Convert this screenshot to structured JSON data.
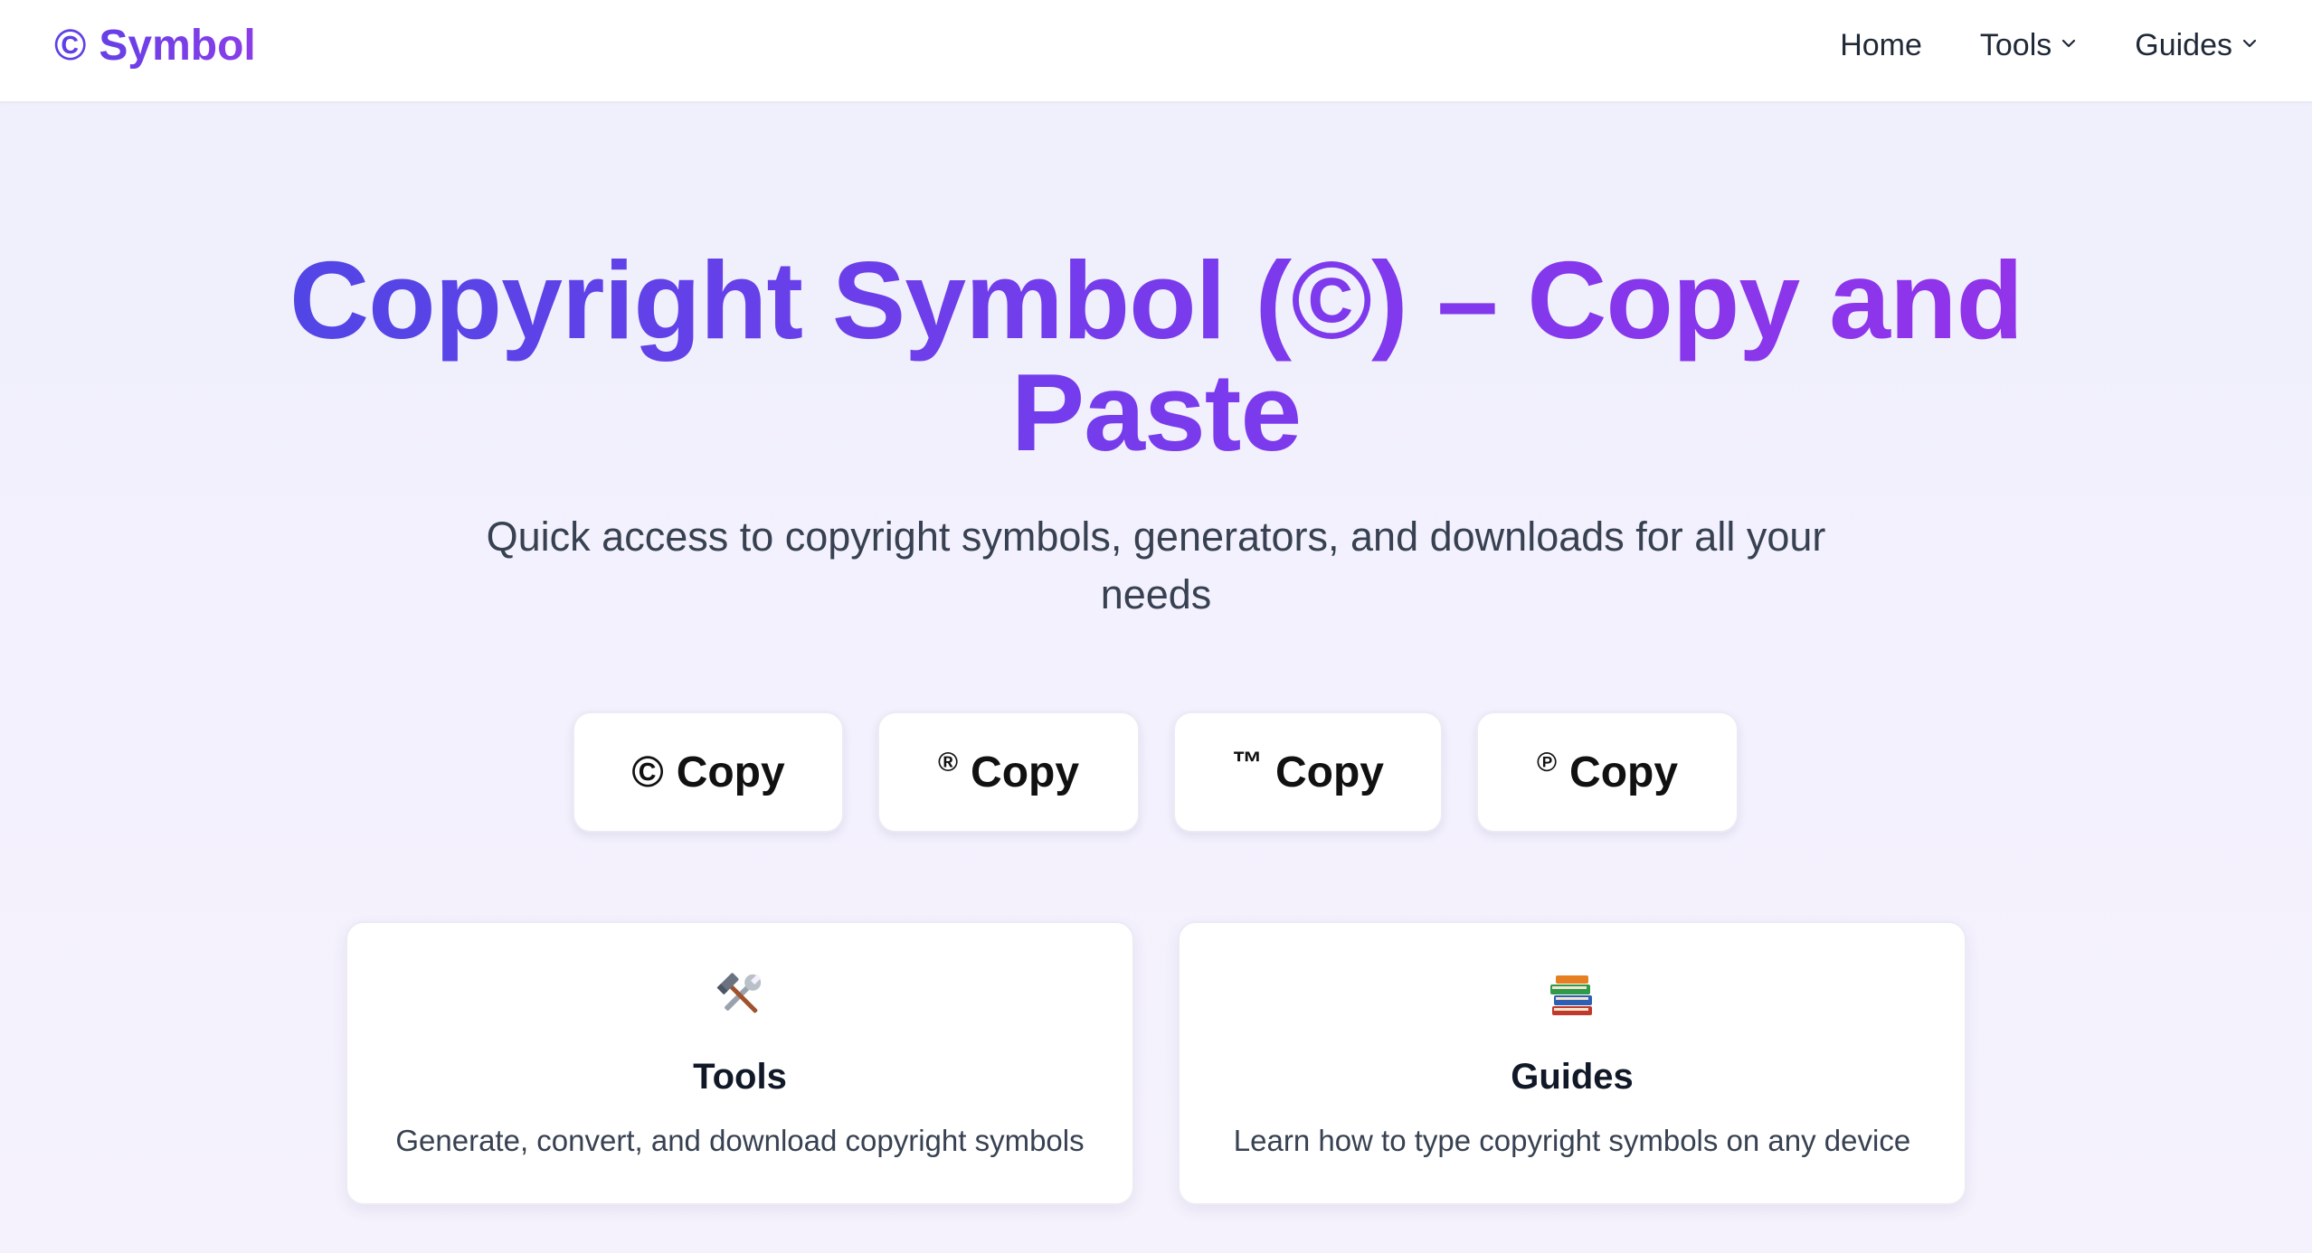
{
  "brand": {
    "logo": "©",
    "name": "Symbol"
  },
  "nav": {
    "home": "Home",
    "tools": "Tools",
    "guides": "Guides"
  },
  "hero": {
    "title_line1": "Copyright Symbol (©) – Copy and",
    "title_line2": "Paste",
    "subtitle_line1": "Quick access to copyright symbols, generators, and downloads for all your",
    "subtitle_line2": "needs"
  },
  "copy_buttons": [
    {
      "symbol": "©",
      "label": "Copy"
    },
    {
      "symbol": "®",
      "label": "Copy"
    },
    {
      "symbol": "™",
      "label": "Copy"
    },
    {
      "symbol": "℗",
      "label": "Copy"
    }
  ],
  "cards": [
    {
      "icon": "hammer-wrench-icon",
      "title": "Tools",
      "description": "Generate, convert, and download copyright symbols"
    },
    {
      "icon": "books-icon",
      "title": "Guides",
      "description": "Learn how to type copyright symbols on any device"
    }
  ],
  "colors": {
    "accent_start": "#4f46e5",
    "accent_end": "#9333ea"
  }
}
